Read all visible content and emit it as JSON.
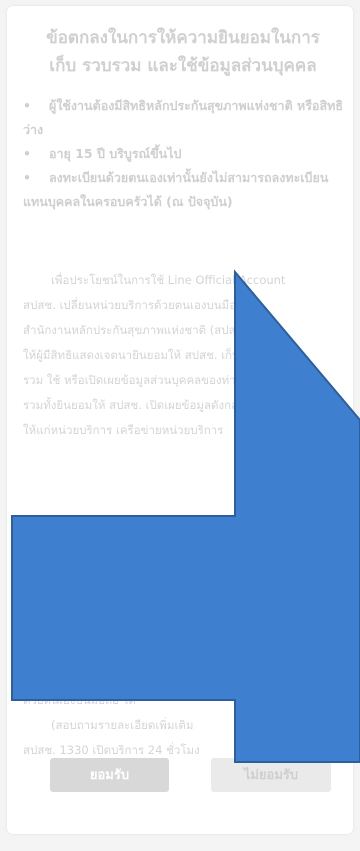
{
  "consent": {
    "title_line1": "ข้อตกลงในการให้ความยินยอมในการ",
    "title_line2": "เก็บ รวบรวม และใช้ข้อมูลส่วนบุคคล",
    "bullets": [
      {
        "dot": "•",
        "text": "ผู้ใช้งานต้องมีสิทธิหลักประกันสุขภาพแห่งชาติ หรือสิทธิว่าง"
      },
      {
        "dot": "•",
        "text": "อายุ 15 ปี บริบูรณ์ขึ้นไป"
      },
      {
        "dot": "•",
        "text": "ลงทะเบียนด้วยตนเองเท่านั้นยังไม่สามารถลงทะเบียนแทนบุคคลในครอบครัวได้ (ณ ปัจจุบัน)"
      }
    ],
    "body_lines": [
      "เพื่อประโยชน์ในการใช้ Line Official Account",
      "สปสช. เปลี่ยนหน่วยบริการด้วยตนเองบนมือถือ",
      "สำนักงานหลักประกันสุขภาพแห่งชาติ (สปสช.) ขอ",
      "ให้ผู้มีสิทธิแสดงเจตนายินยอมให้ สปสช. เก็บ รวบ",
      "รวม ใช้ หรือเปิดเผยข้อมูลส่วนบุคคลของท่าน",
      "รวมทั้งยินยอมให้ สปสช. เปิดเผยข้อมูลดังกล่าว",
      "ให้แก่หน่วยบริการ เครือข่ายหน่วยบริการ"
    ],
    "tail_lines": [
      "ด้วยตนเองบนมือถือ ได้",
      "(สอบถามรายละเอียดเพิ่มเติม",
      "สปสช. 1330 เปิดบริการ 24 ชั่วโมง"
    ],
    "accept_label": "ยอมรับ",
    "reject_label": "ไม่ยอมรับ"
  },
  "overlay": {
    "arrow_color": "#3f7fd0",
    "arrow_edge_color": "#2c5f9e",
    "icon": "right-arrow-icon"
  }
}
